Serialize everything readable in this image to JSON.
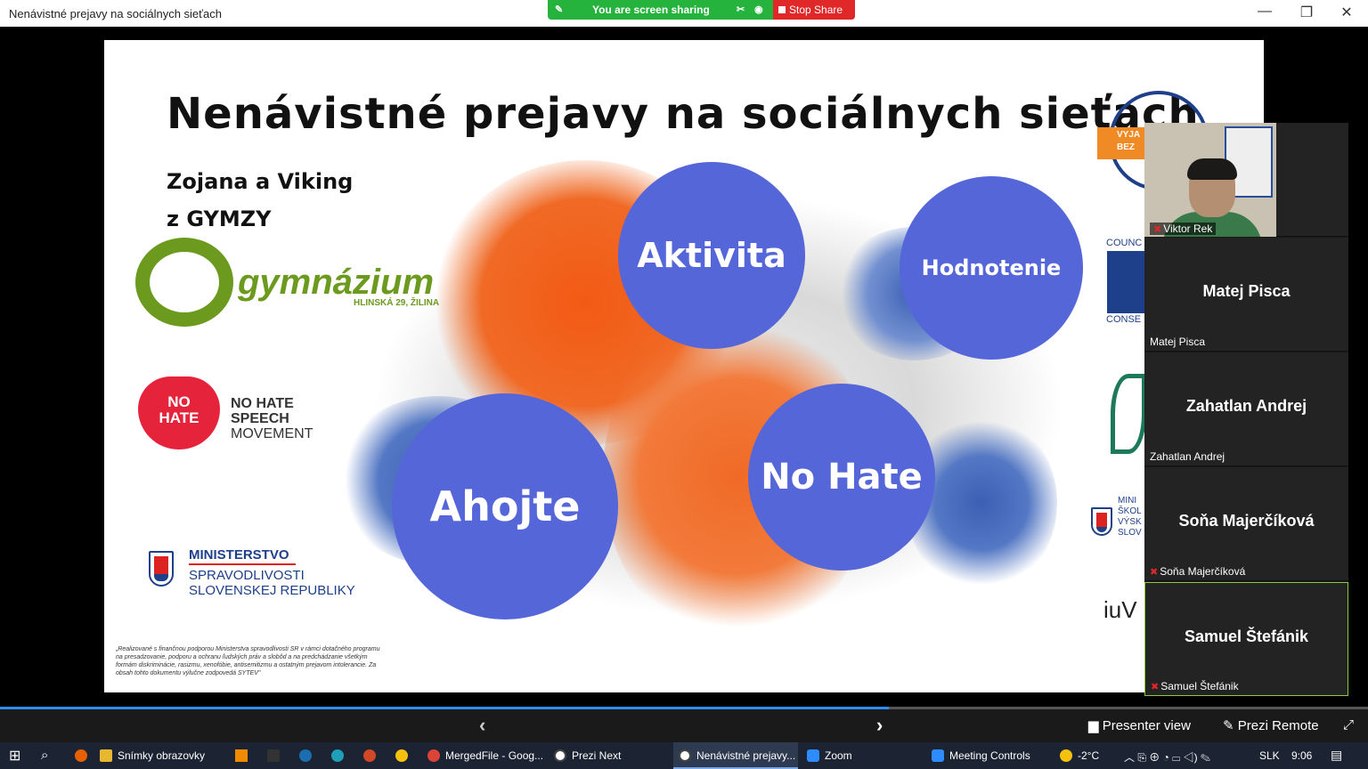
{
  "window": {
    "title": "Nenávistné prejavy na sociálnych sieťach",
    "minimize": "—",
    "restore": "❐",
    "close": "✕"
  },
  "share_bar": {
    "message": "You are screen sharing",
    "stop_label": "Stop Share"
  },
  "slide": {
    "title": "Nenávistné prejavy na sociálnych sieťach",
    "subtitle_1": "Zojana a Viking",
    "subtitle_2": "z GYMZY",
    "circles": [
      "Aktivita",
      "Hodnotenie",
      "Ahojte",
      "No Hate"
    ],
    "gymnazium": "gymnázium",
    "gymnazium_address": "HLINSKÁ 29, ŽILINA",
    "no_hate_badge": [
      "NO",
      "HATE"
    ],
    "no_hate_text": [
      "NO HATE",
      "SPEECH",
      "MOVEMENT"
    ],
    "ministry": [
      "MINISTERSTVO",
      "SPRAVODLIVOSTI",
      "SLOVENSKEJ REPUBLIKY"
    ],
    "fine_print": "„Realizované s finančnou podporou Ministerstva spravodlivosti SR v rámci dotačného programu na presadzovanie, podporu a ochranu ľudských práv a slobôd a na predchádzanie všetkým formám diskriminácie, rasizmu, xenofóbie, antisemitizmu a ostatným prejavom intolerancie. Za obsah tohto dokumentu výlučne zodpovedá SYTEV\"",
    "right_logos": [
      "VYJA",
      "BEZ",
      "COUNC",
      "CONSE",
      "MINI",
      "ŠKOL",
      "VÝSK",
      "SLOV",
      "iuV"
    ]
  },
  "participants": [
    {
      "name": "Viktor Rek",
      "label": "Viktor Rek",
      "video": true,
      "muted": true
    },
    {
      "name": "Matej Pisca",
      "label": "Matej Pisca",
      "muted": false
    },
    {
      "name": "Zahatlan Andrej",
      "label": "Zahatlan Andrej",
      "muted": false
    },
    {
      "name": "Soňa Majerčíková",
      "label": "Soňa Majerčíková",
      "muted": true
    },
    {
      "name": "Samuel Štefánik",
      "label": "Samuel Štefánik",
      "muted": true,
      "active": true
    }
  ],
  "zoom_bar": {
    "prev": "‹",
    "next": "›",
    "presenter_view": "Presenter view",
    "prezi_remote": "Prezi Remote"
  },
  "progress": 0.65,
  "taskbar": {
    "items": [
      "Snímky obrazovky",
      "MergedFile - Goog...",
      "Prezi Next",
      "Nenávistné prejavy...",
      "Zoom",
      "Meeting Controls"
    ],
    "weather": "-2°C",
    "language": "SLK",
    "time": "9:06"
  },
  "colors": {
    "circle": "#5566d9",
    "share_green": "#26b33d",
    "stop_red": "#e02828"
  }
}
